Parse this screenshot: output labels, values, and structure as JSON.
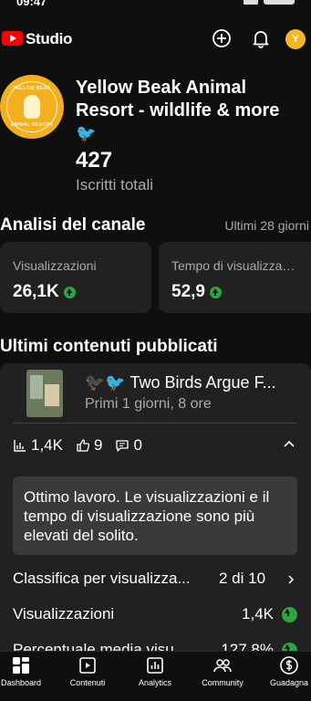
{
  "status_bar": {
    "time": "09:47"
  },
  "header": {
    "brand": "Studio",
    "avatar_initial": "Y"
  },
  "channel": {
    "name": "Yellow Beak Animal Resort - wildlife & more",
    "name_emoji": "🐦",
    "avatar_text_top": "YELLOW BEAK",
    "avatar_text_bottom": "ANIMAL RESORT",
    "subscribers": "427",
    "subscribers_label": "Iscritti totali"
  },
  "analytics": {
    "title": "Analisi del canale",
    "period": "Ultimi 28 giorni",
    "cards": [
      {
        "label": "Visualizzazioni",
        "value": "26,1K",
        "trend": "up"
      },
      {
        "label": "Tempo di visualizzazione (ore)",
        "value": "52,9",
        "trend": "up"
      }
    ]
  },
  "latest": {
    "title": "Ultimi contenuti pubblicati",
    "video": {
      "title": "🐦‍⬛🐦 Two Birds Argue F...",
      "age": "Primi 1 giorni, 8 ore",
      "views": "1,4K",
      "likes": "9",
      "comments": "0"
    },
    "insight": "Ottimo lavoro. Le visualizzazioni e il tempo di visualizzazione sono più elevati del solito.",
    "rows": [
      {
        "label": "Classifica per visualizza...",
        "value": "2 di 10"
      },
      {
        "label": "Visualizzazioni",
        "value": "1,4K"
      },
      {
        "label": "Percentuale media visu...",
        "value": "127,8%"
      }
    ]
  },
  "navbar": {
    "items": [
      {
        "label": "Dashboard",
        "icon": "dashboard-icon",
        "active": true
      },
      {
        "label": "Contenuti",
        "icon": "content-icon"
      },
      {
        "label": "Analytics",
        "icon": "analytics-icon"
      },
      {
        "label": "Community",
        "icon": "community-icon"
      },
      {
        "label": "Guadagna",
        "icon": "earn-icon"
      }
    ]
  },
  "colors": {
    "background": "#0f0f0f",
    "card": "#212121",
    "accent_red": "#ff0000",
    "trend_green": "#2ba640"
  }
}
